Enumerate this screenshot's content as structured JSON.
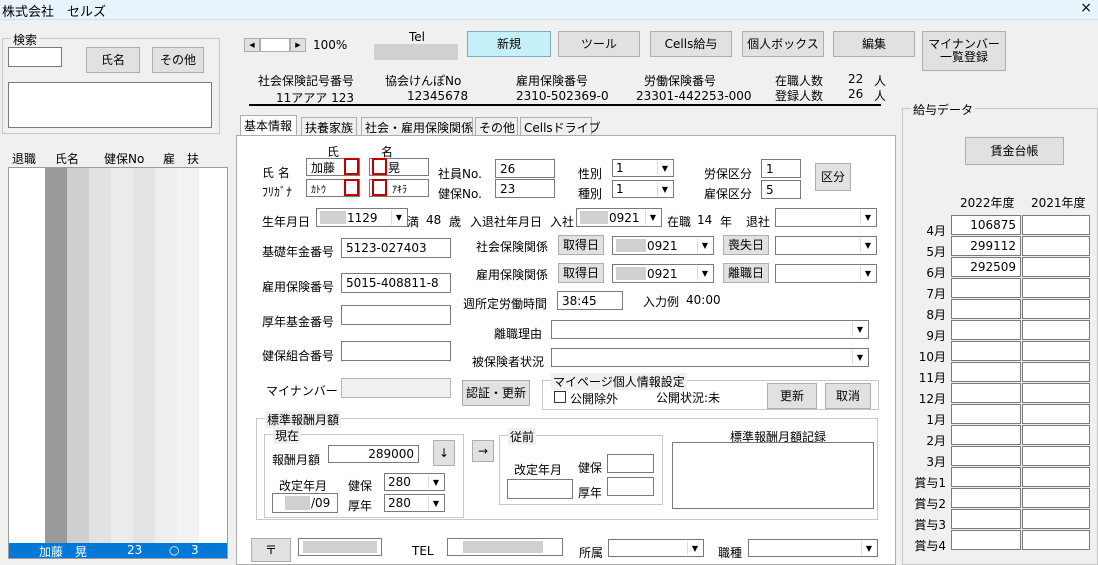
{
  "title": "株式会社　セルズ",
  "close": "×",
  "search": {
    "caption": "検索",
    "name_btn": "氏名",
    "other_btn": "その他"
  },
  "list": {
    "headers": [
      "退職",
      "氏名",
      "健保No",
      "雇",
      "扶"
    ],
    "selected": {
      "name": "加藤　晃",
      "no": "23",
      "koyo": "○",
      "fu": "3"
    }
  },
  "toolbar": {
    "zoom": "100%",
    "tel_label": "Tel",
    "new": "新規",
    "tool": "ツール",
    "cells_pay": "Cells給与",
    "personal_box": "個人ボックス",
    "edit": "編集",
    "my_number": "マイナンバー\n一覧登録"
  },
  "info": {
    "shakai_label": "社会保険記号番号",
    "shakai_val": "11アアア 123",
    "kyokai_label": "協会けんぽNo",
    "kyokai_val": "12345678",
    "koyo_label": "雇用保険番号",
    "koyo_val": "2310-502369-0",
    "rodo_label": "労働保険番号",
    "rodo_val": "23301-442253-000",
    "zaishoku_label": "在職人数",
    "zaishoku_val": "22",
    "toroku_label": "登録人数",
    "toroku_val": "26",
    "nin": "人"
  },
  "tabs": [
    "基本情報",
    "扶養家族",
    "社会・雇用保険関係",
    "その他",
    "Cellsドライブ"
  ],
  "form": {
    "shimei": "氏 名",
    "furigana": "ﾌﾘｶﾞﾅ",
    "shi": "氏",
    "mei": "名",
    "last_name": "加藤",
    "first_name": "晃",
    "last_kana": "ｶﾄｳ",
    "first_kana": "ｱｷﾗ",
    "shain_label": "社員No.",
    "shain_val": "26",
    "kenpo_label": "健保No.",
    "kenpo_val": "23",
    "seibetsu_label": "性別",
    "seibetsu_val": "1",
    "shubetsu_label": "種別",
    "shubetsu_val": "1",
    "rouho_label": "労保区分",
    "rouho_val": "1",
    "koyo_kubun_label": "雇保区分",
    "koyo_kubun_val": "5",
    "kubun_btn": "区分",
    "birth_label": "生年月日",
    "birth_val": "1129",
    "man": "満",
    "age": "48",
    "sai": "歳",
    "nyusha_label": "入退社年月日",
    "nyusha": "入社",
    "nyusha_val": "0921",
    "zaishoku": "在職",
    "years": "14",
    "nen": "年",
    "taisha": "退社",
    "kiso_label": "基礎年金番号",
    "kiso_val": "5123-027403",
    "shakai_label": "社会保険関係",
    "shutoku": "取得日",
    "shakai_date": "0921",
    "soshitsu": "喪失日",
    "koyo_label": "雇用保険番号",
    "koyo_val": "5015-408811-8",
    "koyo_rel_label": "雇用保険関係",
    "koyo_date": "0921",
    "rishoku": "離職日",
    "shutei_label": "週所定労働時間",
    "shutei_val": "38:45",
    "nyuryoku": "入力例",
    "nyuryoku_val": "40:00",
    "kosei_label": "厚年基金番号",
    "rishoku_riyu": "離職理由",
    "kenpo_kumiai_label": "健保組合番号",
    "hihoken": "被保険者状況",
    "mynumber_label": "マイナンバー",
    "ninsho": "認証・更新",
    "mypage_caption": "マイページ個人情報設定",
    "kokai_jogai": "公開除外",
    "kokai_status": "公開状況:未",
    "koshin": "更新",
    "torikeshi": "取消"
  },
  "hyojun": {
    "caption": "標準報酬月額",
    "genzai": "現在",
    "hoshu_label": "報酬月額",
    "hoshu_val": "289000",
    "down": "↓",
    "kaitei_label": "改定年月",
    "kaitei_val": "/09",
    "kenpo_l": "健保",
    "kenpo_v": "280",
    "kosei_l": "厚年",
    "kosei_v": "280",
    "arrow": "→",
    "juzen": "従前",
    "juzen_kaitei": "改定年月",
    "juzen_kenpo": "健保",
    "juzen_kosei": "厚年",
    "kiroku": "標準報酬月額記録"
  },
  "bottom": {
    "postal": "〒",
    "tel": "TEL",
    "shozoku": "所属",
    "shokushu": "職種"
  },
  "salary": {
    "caption": "給与データ",
    "ledger": "賃金台帳",
    "year1": "2022年度",
    "year2": "2021年度",
    "months": [
      "4月",
      "5月",
      "6月",
      "7月",
      "8月",
      "9月",
      "10月",
      "11月",
      "12月",
      "1月",
      "2月",
      "3月",
      "賞与1",
      "賞与2",
      "賞与3",
      "賞与4"
    ],
    "values2022": [
      "106875",
      "299112",
      "292509",
      "",
      "",
      "",
      "",
      "",
      "",
      "",
      "",
      "",
      "",
      "",
      "",
      ""
    ]
  }
}
